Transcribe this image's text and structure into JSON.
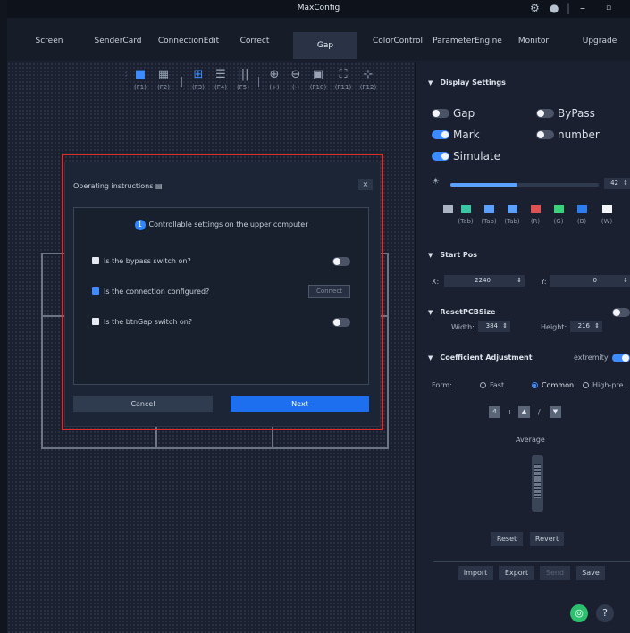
{
  "app": {
    "title": "MaxConfig"
  },
  "menu": [
    "Screen",
    "SenderCard",
    "ConnectionEdit",
    "Correct",
    "Gap",
    "ColorControl",
    "ParameterEngine",
    "Monitor",
    "Upgrade"
  ],
  "menu_active": "Gap",
  "toolbar": [
    "(F1)",
    "(F2)",
    "(F3)",
    "(F4)",
    "(F5)",
    "(+)",
    "(-)",
    "(F10)",
    "(F11)",
    "(F12)"
  ],
  "dialog": {
    "title": "Operating instructions",
    "step_number": "1",
    "step_text": "Controllable settings on the upper computer",
    "items": [
      {
        "label": "Is the bypass switch on?",
        "checked": false
      },
      {
        "label": "Is the connection configured?",
        "checked": true
      },
      {
        "label": "Is the btnGap switch on?",
        "checked": false
      }
    ],
    "connect_label": "Connect",
    "cancel_label": "Cancel",
    "next_label": "Next",
    "close_glyph": "×"
  },
  "display_settings": {
    "title": "Display Settings",
    "switches": [
      {
        "label": "Gap",
        "on": false
      },
      {
        "label": "ByPass",
        "on": false
      },
      {
        "label": "Mark",
        "on": true
      },
      {
        "label": "number",
        "on": false
      },
      {
        "label": "Simulate",
        "on": true
      }
    ],
    "brightness_value": "42",
    "brightness_fraction": 0.45,
    "color_tabs": [
      "(Tab)",
      "(Tab)",
      "(Tab)",
      "(R)",
      "(G)",
      "(B)",
      "(W)"
    ],
    "colors": {
      "r": "#e05252",
      "g": "#39d47a",
      "b": "#2d7df0",
      "w": "#f2f4f7",
      "tab": "#5aa0ff"
    }
  },
  "start_pos": {
    "title": "Start Pos",
    "x_label": "X:",
    "x_value": "2240",
    "y_label": "Y:",
    "y_value": "0"
  },
  "reset_pcb": {
    "title": "ResetPCBSize",
    "width_label": "Width:",
    "width_value": "384",
    "height_label": "Height:",
    "height_value": "216"
  },
  "coefficient": {
    "title": "Coefficient Adjustment",
    "extremity_label": "extremity",
    "form_label": "Form:",
    "options": [
      "Fast",
      "Common",
      "High-pre.."
    ],
    "selected": "Common",
    "expr_a": "4",
    "expr_plus": "+",
    "expr_slash": "/",
    "mode_label": "Average",
    "reset_label": "Reset",
    "revert_label": "Revert"
  },
  "footer_buttons": {
    "import": "Import",
    "export": "Export",
    "send": "Send",
    "save": "Save"
  },
  "accent": "#3d8bff"
}
